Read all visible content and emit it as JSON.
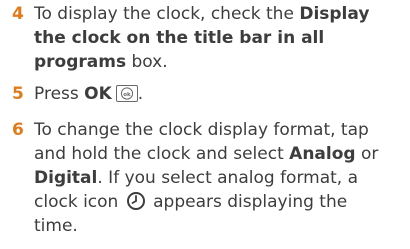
{
  "steps": [
    {
      "number": "4",
      "line1_text": "To display the clock, check the ",
      "line1_bold": "Display",
      "line2_bold": "the clock on the title bar in all",
      "line3_bold": "programs",
      "line3_text": " box."
    },
    {
      "number": "5",
      "text": "Press ",
      "bold": "OK",
      "key_icon": "ok-key-icon",
      "end": "."
    },
    {
      "number": "6",
      "line1": "To change the clock display format, tap",
      "line2_text": "and hold the clock and select ",
      "line2_bold": "Analog",
      "line2_end": " or",
      "line3_bold": "Digital",
      "line3_text": ". If you select analog format, a",
      "line4_pre": "clock icon ",
      "line4_icon": "clock-icon",
      "line4_post": " appears displaying the",
      "line5": "time."
    }
  ]
}
